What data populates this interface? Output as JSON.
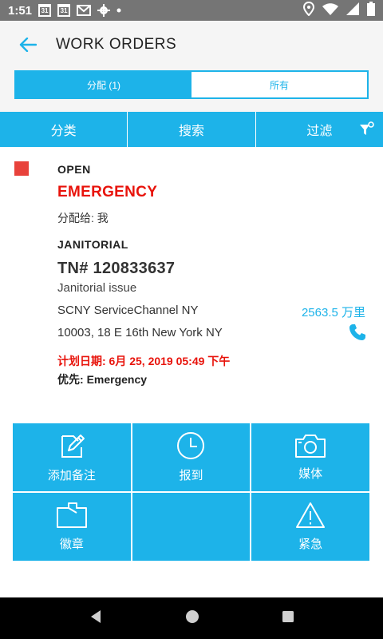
{
  "status_bar": {
    "time": "1:51",
    "cal1": "31",
    "cal2": "31"
  },
  "app_bar": {
    "title": "WORK ORDERS"
  },
  "segments": {
    "assigned": "分配 (1)",
    "all": "所有"
  },
  "action_bar": {
    "category": "分类",
    "search": "搜索",
    "filter": "过滤"
  },
  "work_order": {
    "status": "OPEN",
    "priority_heading": "EMERGENCY",
    "assigned_to": "分配给: 我",
    "category": "JANITORIAL",
    "tracking_number": "TN# 120833637",
    "description": "Janitorial issue",
    "location": "SCNY ServiceChannel NY",
    "distance": "2563.5 万里",
    "address": "10003, 18 E 16th New York NY",
    "scheduled": "计划日期: 6月 25, 2019 05:49 下午",
    "priority_label": "优先: ",
    "priority_value": "Emergency",
    "status_color": "#e8423b"
  },
  "actions": {
    "add_note": "添加备注",
    "check_in": "报到",
    "media": "媒体",
    "badge": "徽章",
    "emergency": "紧急"
  },
  "colors": {
    "accent": "#1db3e9",
    "alert": "#e8130b"
  }
}
